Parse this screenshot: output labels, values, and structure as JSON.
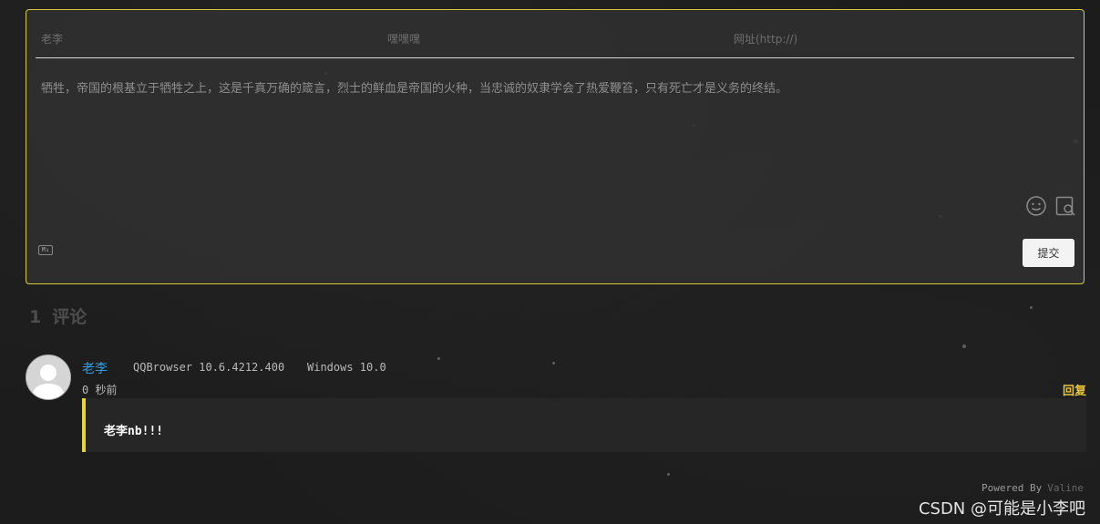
{
  "editor": {
    "nick_placeholder": "老李",
    "mail_placeholder": "嘿嘿嘿",
    "link_placeholder": "网址(http://)",
    "comment_text": "牺牲，帝国的根基立于牺牲之上，这是千真万确的箴言，烈士的鲜血是帝国的火种，当忠诚的奴隶学会了热爱鞭笞，只有死亡才是义务的终结。",
    "markdown_badge": "M↓",
    "submit_label": "提交",
    "accent_color": "#d6c93a"
  },
  "comments_header": {
    "count": "1",
    "label": "评论"
  },
  "comment": {
    "nick": "老李",
    "browser": "QQBrowser 10.6.4212.400",
    "os": "Windows 10.0",
    "time": "0 秒前",
    "reply_label": "回复",
    "content": "老李nb!!!"
  },
  "footer": {
    "powered_by": "Powered By",
    "brand": "Valine"
  },
  "watermark": "CSDN @可能是小李吧"
}
